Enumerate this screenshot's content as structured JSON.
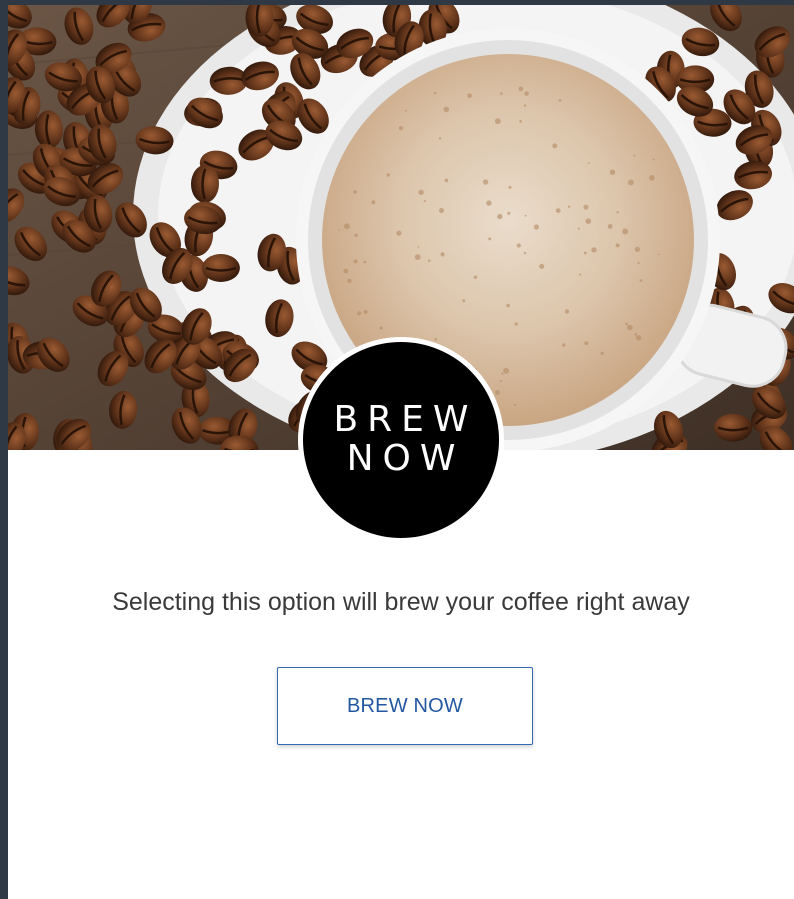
{
  "hero": {
    "image_alt": "coffee-cup-with-beans"
  },
  "badge": {
    "line1": "BREW",
    "line2": "NOW"
  },
  "description": "Selecting this option will brew your coffee right away",
  "cta": {
    "label": "BREW NOW"
  },
  "colors": {
    "page_background": "#2e3945",
    "card_background": "#ffffff",
    "badge_background": "#000000",
    "button_border": "#2f6ab3",
    "button_text": "#2358a0",
    "description_text": "#3a3a3a"
  }
}
